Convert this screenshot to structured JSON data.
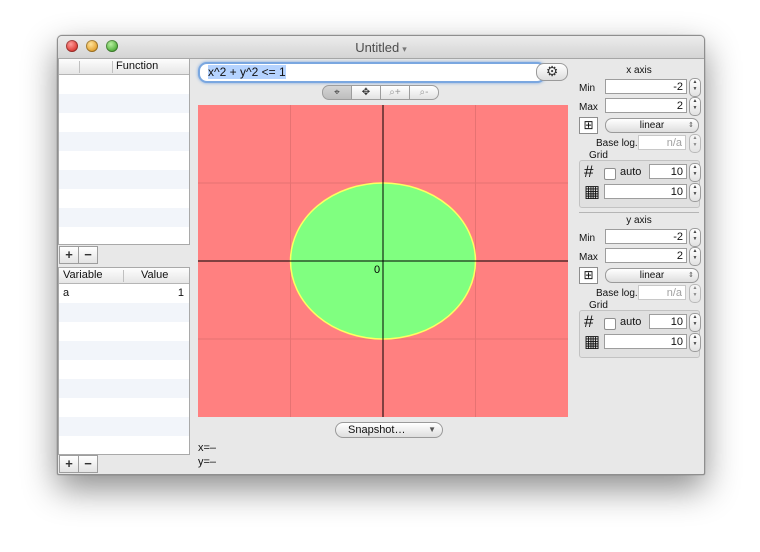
{
  "window": {
    "title": "Untitled"
  },
  "functions": {
    "header": "Function",
    "rows": []
  },
  "variables": {
    "header_variable": "Variable",
    "header_value": "Value",
    "rows": [
      {
        "name": "a",
        "value": "1"
      }
    ]
  },
  "buttons": {
    "add": "+",
    "remove": "−",
    "snapshot": "Snapshot…"
  },
  "formula": "x^2 + y^2 <= 1",
  "plot": {
    "origin_label": "0",
    "x_range": [
      -2,
      2
    ],
    "y_range": [
      -2,
      2
    ],
    "region_color": "#80ff80",
    "background_color": "#ff8080",
    "boundary_color": "#ffff60",
    "shape": "unit disc"
  },
  "status": {
    "x": "x=–",
    "y": "y=–"
  },
  "x_axis": {
    "title": "x axis",
    "min_label": "Min",
    "min": "-2",
    "max_label": "Max",
    "max": "2",
    "scale": "linear",
    "base_log_label": "Base log.",
    "base_log": "n/a",
    "grid_label": "Grid",
    "auto_label": "auto",
    "major": "10",
    "minor": "10"
  },
  "y_axis": {
    "title": "y axis",
    "min_label": "Min",
    "min": "-2",
    "max_label": "Max",
    "max": "2",
    "scale": "linear",
    "base_log_label": "Base log.",
    "base_log": "n/a",
    "grid_label": "Grid",
    "auto_label": "auto",
    "major": "10",
    "minor": "10"
  }
}
